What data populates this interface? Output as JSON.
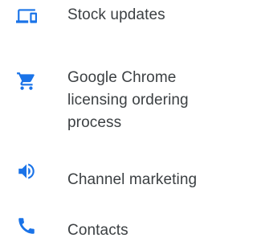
{
  "menu": {
    "items": [
      {
        "label": "Stock updates",
        "icon": "devices-icon",
        "icon_color": "#1a73e8"
      },
      {
        "label": "Google Chrome licensing ordering process",
        "icon": "shopping-cart-icon",
        "icon_color": "#1a73e8"
      },
      {
        "label": "Channel marketing",
        "icon": "speaker-icon",
        "icon_color": "#1a73e8"
      },
      {
        "label": "Contacts",
        "icon": "phone-icon",
        "icon_color": "#1a73e8"
      }
    ]
  },
  "colors": {
    "accent": "#1a73e8",
    "text": "#3c4043",
    "background": "#ffffff"
  }
}
